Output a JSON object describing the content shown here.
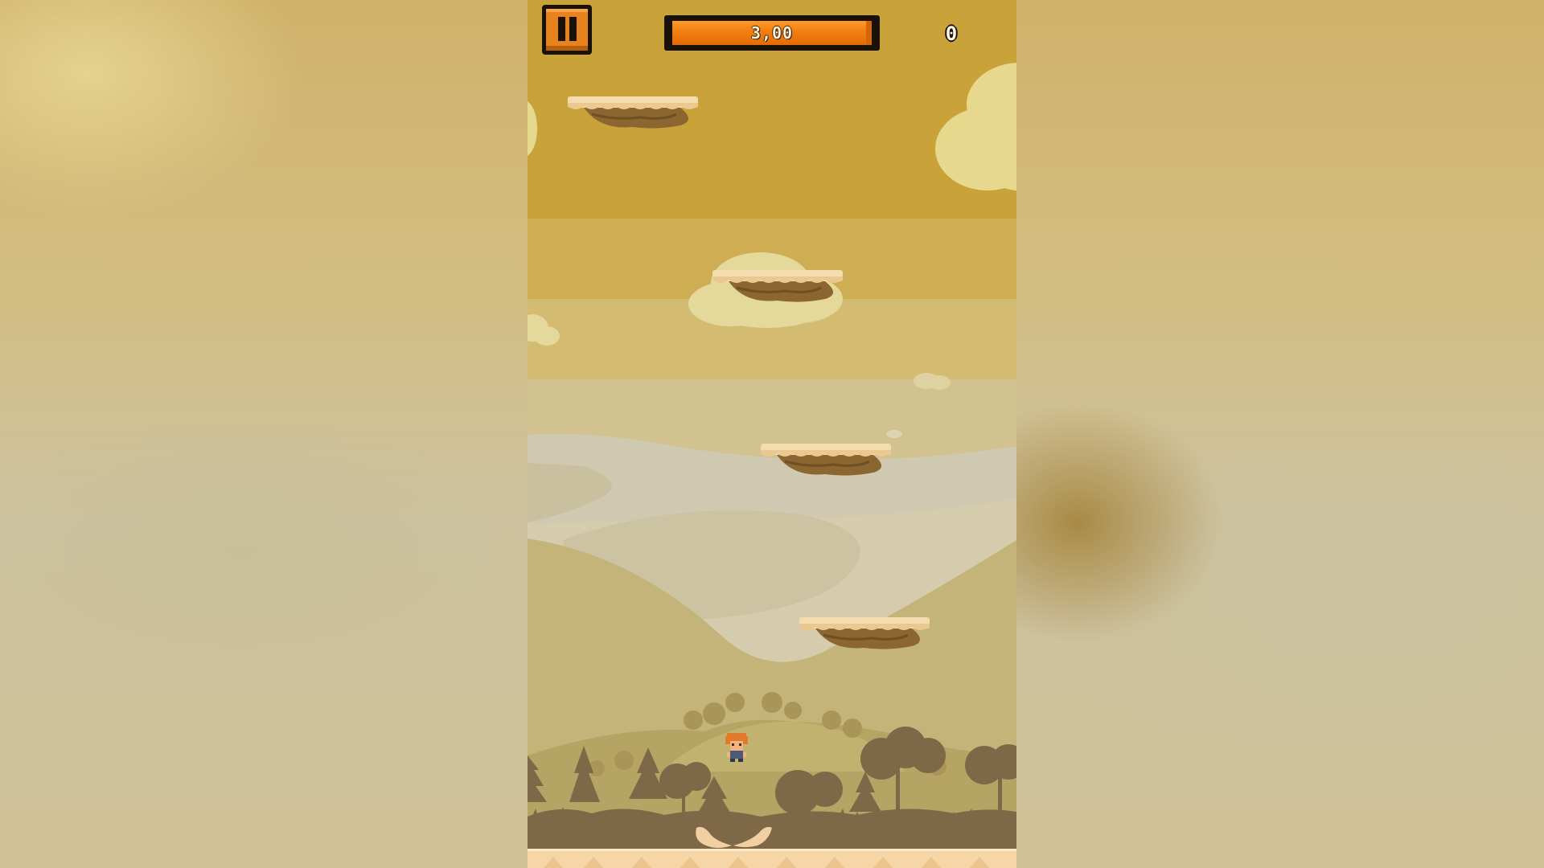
{
  "hud": {
    "pause_icon": "pause-icon",
    "timer_value": "3,00",
    "timer_fill_fraction": 0.97,
    "score": "0"
  },
  "palette": {
    "sky_top": "#c9a23a",
    "sky_band_2": "#cfae52",
    "sky_band_3": "#d3bb72",
    "sky_band_4": "#d1c18f",
    "haze": "#d5ccad",
    "hill_back": "#c4b479",
    "hill_front": "#b5a463",
    "forest": "#7e6847",
    "ground": "#f6d5a6",
    "platform_top": "#f4dcae",
    "platform_dirt": "#8c6630",
    "player_hair": "#e27a2c",
    "player_body": "#4c5a78",
    "timer_fill": "#f27d10",
    "pause_button": "#e8821c"
  }
}
